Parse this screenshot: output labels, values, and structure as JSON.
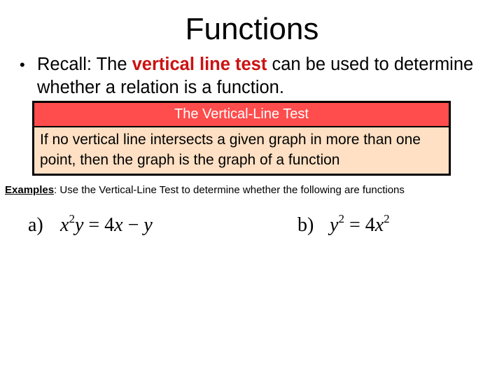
{
  "slide": {
    "title": "Functions",
    "bullet": {
      "marker": "•",
      "prefix": "Recall: The ",
      "highlight": "vertical line test",
      "suffix": " can be used to determine whether a relation is a function."
    },
    "theorem_box": {
      "header": "The Vertical-Line Test",
      "body": "If no vertical line intersects a given graph in more than one point, then the graph is the graph of a function"
    },
    "examples": {
      "label": "Examples",
      "text": ": Use the Vertical-Line Test to determine whether the following are functions"
    },
    "equations": [
      {
        "label": "a)",
        "lhs_var1": "x",
        "lhs_exp1": "2",
        "lhs_var2": "y",
        "equals": "=",
        "rhs_coef": "4",
        "rhs_var1": "x",
        "minus": "−",
        "rhs_var2": "y"
      },
      {
        "label": "b)",
        "lhs_var1": "y",
        "lhs_exp1": "2",
        "equals": "=",
        "rhs_coef": "4",
        "rhs_var1": "x",
        "rhs_exp1": "2"
      }
    ],
    "colors": {
      "highlight_text": "#cc1111",
      "box_header_bg": "#ff4c4c",
      "box_body_bg": "#ffe0c4",
      "box_border": "#000000",
      "box_header_text": "#ffffff"
    }
  }
}
